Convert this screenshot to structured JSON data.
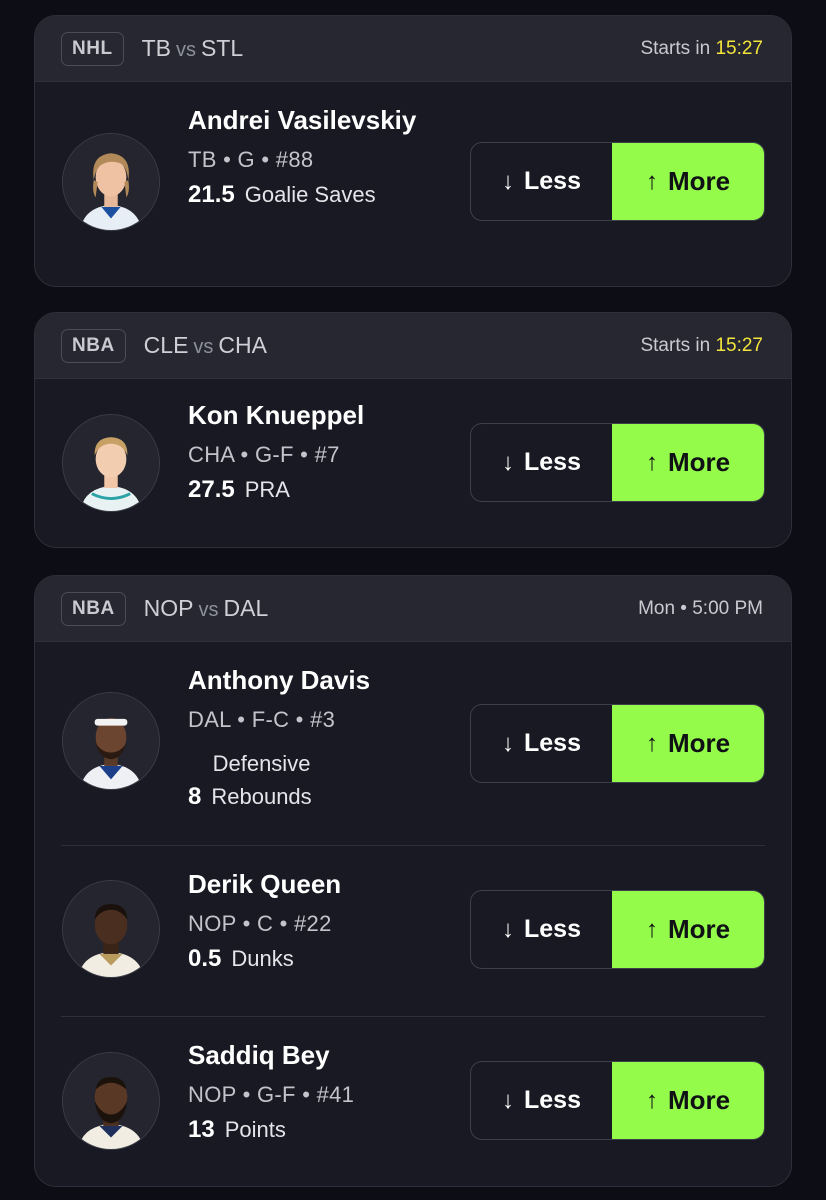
{
  "cards": [
    {
      "league": "NHL",
      "team1": "TB",
      "vs": "vs",
      "team2": "STL",
      "time_prefix": "Starts in",
      "countdown": "15:27",
      "players": [
        {
          "name": "Andrei Vasilevskiy",
          "meta": "TB • G • #88",
          "line": "21.5",
          "stat": "Goalie Saves",
          "less_label": "Less",
          "more_label": "More"
        }
      ]
    },
    {
      "league": "NBA",
      "team1": "CLE",
      "vs": "vs",
      "team2": "CHA",
      "time_prefix": "Starts in",
      "countdown": "15:27",
      "players": [
        {
          "name": "Kon Knueppel",
          "meta": "CHA • G-F • #7",
          "line": "27.5",
          "stat": "PRA",
          "less_label": "Less",
          "more_label": "More"
        }
      ]
    },
    {
      "league": "NBA",
      "team1": "NOP",
      "vs": "vs",
      "team2": "DAL",
      "time": "Mon • 5:00 PM",
      "players": [
        {
          "name": "Anthony Davis",
          "meta": "DAL • F-C • #3",
          "line": "8",
          "stat_line1": "Defensive",
          "stat": "Rebounds",
          "less_label": "Less",
          "more_label": "More"
        },
        {
          "name": "Derik Queen",
          "meta": "NOP • C • #22",
          "line": "0.5",
          "stat": "Dunks",
          "less_label": "Less",
          "more_label": "More"
        },
        {
          "name": "Saddiq Bey",
          "meta": "NOP • G-F • #41",
          "line": "13",
          "stat": "Points",
          "less_label": "Less",
          "more_label": "More"
        }
      ]
    }
  ],
  "icons": {
    "less": "arrow-down-icon",
    "more": "arrow-up-icon"
  },
  "colors": {
    "background": "#0d0e15",
    "card": "#181922",
    "header": "#262731",
    "more_button": "#94fb4b",
    "countdown": "#f3e53a"
  }
}
